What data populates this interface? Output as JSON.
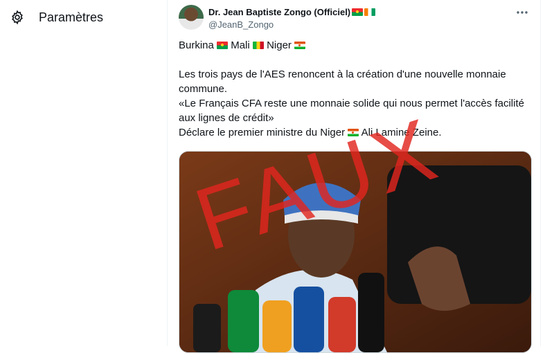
{
  "nav": {
    "settings_label": "Paramètres",
    "settings_icon": "gear-icon"
  },
  "tweet": {
    "author_name": "Dr. Jean Baptiste Zongo (Officiel)",
    "handle": "@JeanB_Zongo",
    "name_flags": [
      "burkina-faso-flag",
      "cote-divoire-flag"
    ],
    "countries": [
      {
        "name": "Burkina",
        "flag": "burkina-faso-flag"
      },
      {
        "name": "Mali",
        "flag": "mali-flag"
      },
      {
        "name": "Niger",
        "flag": "niger-flag"
      }
    ],
    "line1": "Les trois pays de l'AES renoncent à la création d'une nouvelle monnaie commune.",
    "quote": "«Le Français CFA reste une monnaie solide qui nous permet l'accès facilité aux lignes de crédit»",
    "declare_prefix": "Déclare le premier ministre du Niger",
    "declare_suffix": "Ali Lamine Zeine."
  },
  "overlay": {
    "stamp_text": "FAUX",
    "stamp_color": "#e2261e"
  },
  "colors": {
    "text": "#0f1419",
    "secondary": "#536471",
    "border": "#eff3f4"
  }
}
